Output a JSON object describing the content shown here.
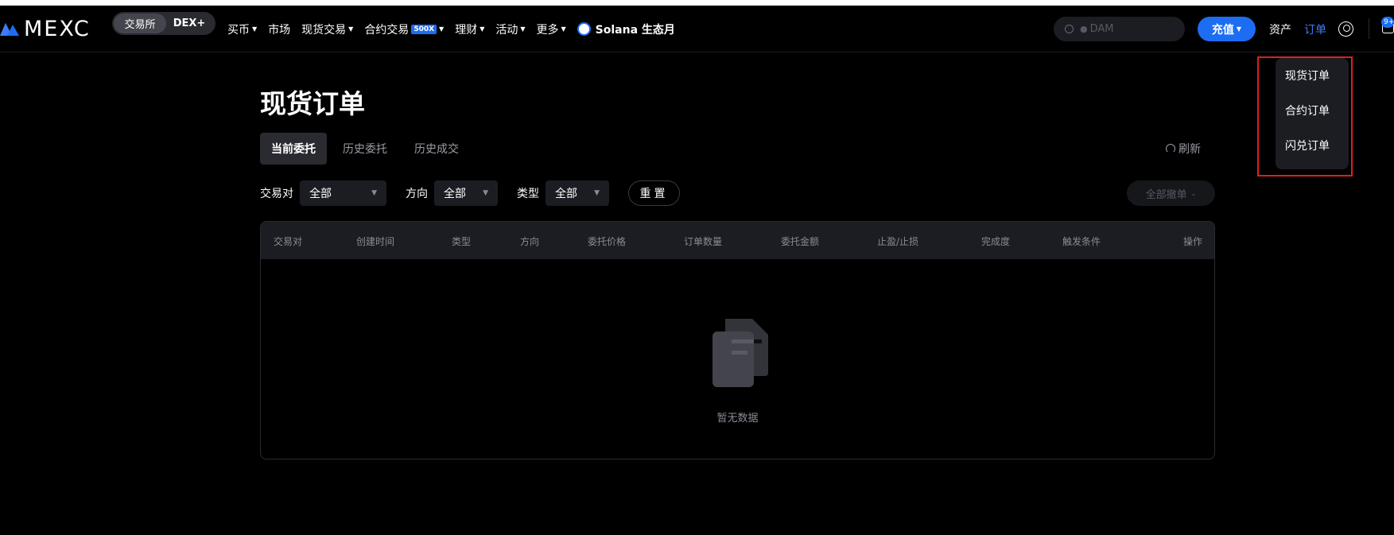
{
  "brand": {
    "logo_text": "MEXC"
  },
  "mode_toggle": {
    "exchange": "交易所",
    "dex": "DEX+"
  },
  "nav": {
    "buy_crypto": "买币",
    "markets": "市场",
    "spot": "现货交易",
    "futures": "合约交易",
    "futures_badge": "500X",
    "earn": "理财",
    "events": "活动",
    "more": "更多",
    "solana": "Solana 生态月"
  },
  "search": {
    "placeholder": "DAM"
  },
  "header": {
    "deposit": "充值",
    "assets": "资产",
    "orders": "订单",
    "msg_badge": "9+"
  },
  "orders_menu": {
    "items": [
      "现货订单",
      "合约订单",
      "闪兑订单"
    ]
  },
  "page": {
    "title": "现货订单"
  },
  "tabs": [
    "当前委托",
    "历史委托",
    "历史成交"
  ],
  "refresh": "刷新",
  "filters": {
    "pair_label": "交易对",
    "pair_value": "全部",
    "side_label": "方向",
    "side_value": "全部",
    "type_label": "类型",
    "type_value": "全部",
    "reset": "重置",
    "cancel_all": "全部撤单"
  },
  "table": {
    "columns": [
      "交易对",
      "创建时间",
      "类型",
      "方向",
      "委托价格",
      "订单数量",
      "委托金额",
      "止盈/止损",
      "完成度",
      "触发条件",
      "操作"
    ],
    "empty_text": "暂无数据"
  },
  "colors": {
    "accent": "#1d6df2",
    "highlight_box": "#e01f1f",
    "background": "#000000"
  }
}
